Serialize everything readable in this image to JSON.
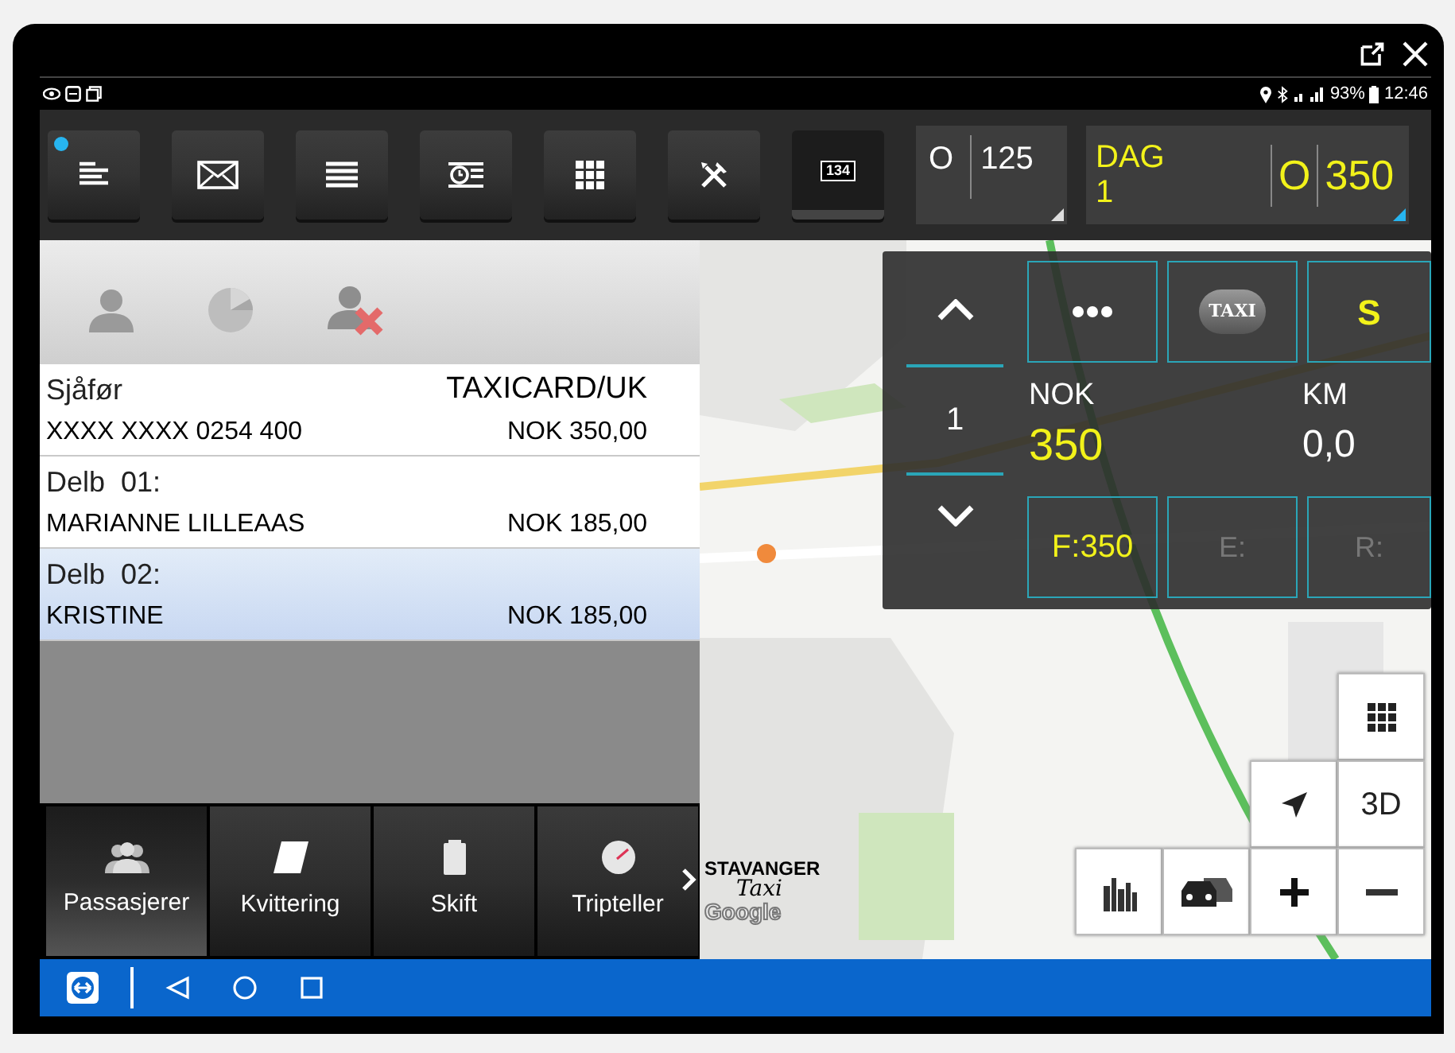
{
  "status_bar": {
    "battery": "93%",
    "time": "12:46"
  },
  "toolbar": {
    "buttons": [
      {
        "kind": "menu",
        "notification": true,
        "selected": false
      },
      {
        "kind": "mail",
        "notification": false,
        "selected": false
      },
      {
        "kind": "list",
        "notification": false,
        "selected": false
      },
      {
        "kind": "clock",
        "notification": false,
        "selected": false
      },
      {
        "kind": "grid",
        "notification": false,
        "selected": false
      },
      {
        "kind": "tools",
        "notification": false,
        "selected": false
      },
      {
        "kind": "counter",
        "label": "134",
        "notification": false,
        "selected": true
      }
    ],
    "counter_left": {
      "label": "O",
      "value": "125"
    },
    "counter_right": {
      "label": "DAG",
      "number": "1",
      "mark": "O",
      "value": "350"
    }
  },
  "payments": [
    {
      "title": "Sjåfør",
      "method": "TAXICARD/UK",
      "name": "XXXX XXXX 0254 400",
      "amount": "NOK 350,00",
      "selected": false
    },
    {
      "title": "Delb  01:",
      "name": "MARIANNE LILLEAAS",
      "amount": "NOK 185,00",
      "selected": false
    },
    {
      "title": "Delb  02:",
      "name": "KRISTINE",
      "amount": "NOK 185,00",
      "selected": true
    }
  ],
  "bottom_tabs": [
    {
      "kind": "people",
      "label": "Passasjerer",
      "selected": true
    },
    {
      "kind": "receipt",
      "label": "Kvittering",
      "selected": false
    },
    {
      "kind": "shift",
      "label": "Skift",
      "selected": false
    },
    {
      "kind": "gauge",
      "label": "Tripteller",
      "selected": false
    }
  ],
  "meter": {
    "count": "1",
    "taxi": "TAXI",
    "status": "S",
    "nok_label": "NOK",
    "nok": "350",
    "km_label": "KM",
    "km": "0,0",
    "fixed": "F:350",
    "extra": "E:",
    "rest": "R:"
  },
  "map": {
    "controls_3d": "3D",
    "logo_top": "STAVANGER",
    "logo_bottom": "Taxi",
    "attribution": "Google"
  }
}
